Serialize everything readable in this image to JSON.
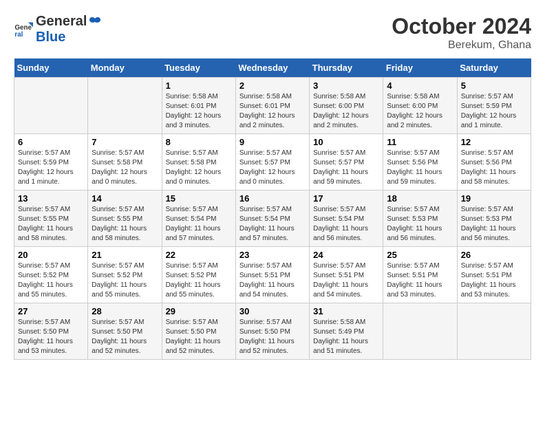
{
  "header": {
    "logo_line1": "General",
    "logo_line2": "Blue",
    "month": "October 2024",
    "location": "Berekum, Ghana"
  },
  "weekdays": [
    "Sunday",
    "Monday",
    "Tuesday",
    "Wednesday",
    "Thursday",
    "Friday",
    "Saturday"
  ],
  "weeks": [
    [
      {
        "day": "",
        "info": ""
      },
      {
        "day": "",
        "info": ""
      },
      {
        "day": "1",
        "info": "Sunrise: 5:58 AM\nSunset: 6:01 PM\nDaylight: 12 hours\nand 3 minutes."
      },
      {
        "day": "2",
        "info": "Sunrise: 5:58 AM\nSunset: 6:01 PM\nDaylight: 12 hours\nand 2 minutes."
      },
      {
        "day": "3",
        "info": "Sunrise: 5:58 AM\nSunset: 6:00 PM\nDaylight: 12 hours\nand 2 minutes."
      },
      {
        "day": "4",
        "info": "Sunrise: 5:58 AM\nSunset: 6:00 PM\nDaylight: 12 hours\nand 2 minutes."
      },
      {
        "day": "5",
        "info": "Sunrise: 5:57 AM\nSunset: 5:59 PM\nDaylight: 12 hours\nand 1 minute."
      }
    ],
    [
      {
        "day": "6",
        "info": "Sunrise: 5:57 AM\nSunset: 5:59 PM\nDaylight: 12 hours\nand 1 minute."
      },
      {
        "day": "7",
        "info": "Sunrise: 5:57 AM\nSunset: 5:58 PM\nDaylight: 12 hours\nand 0 minutes."
      },
      {
        "day": "8",
        "info": "Sunrise: 5:57 AM\nSunset: 5:58 PM\nDaylight: 12 hours\nand 0 minutes."
      },
      {
        "day": "9",
        "info": "Sunrise: 5:57 AM\nSunset: 5:57 PM\nDaylight: 12 hours\nand 0 minutes."
      },
      {
        "day": "10",
        "info": "Sunrise: 5:57 AM\nSunset: 5:57 PM\nDaylight: 11 hours\nand 59 minutes."
      },
      {
        "day": "11",
        "info": "Sunrise: 5:57 AM\nSunset: 5:56 PM\nDaylight: 11 hours\nand 59 minutes."
      },
      {
        "day": "12",
        "info": "Sunrise: 5:57 AM\nSunset: 5:56 PM\nDaylight: 11 hours\nand 58 minutes."
      }
    ],
    [
      {
        "day": "13",
        "info": "Sunrise: 5:57 AM\nSunset: 5:55 PM\nDaylight: 11 hours\nand 58 minutes."
      },
      {
        "day": "14",
        "info": "Sunrise: 5:57 AM\nSunset: 5:55 PM\nDaylight: 11 hours\nand 58 minutes."
      },
      {
        "day": "15",
        "info": "Sunrise: 5:57 AM\nSunset: 5:54 PM\nDaylight: 11 hours\nand 57 minutes."
      },
      {
        "day": "16",
        "info": "Sunrise: 5:57 AM\nSunset: 5:54 PM\nDaylight: 11 hours\nand 57 minutes."
      },
      {
        "day": "17",
        "info": "Sunrise: 5:57 AM\nSunset: 5:54 PM\nDaylight: 11 hours\nand 56 minutes."
      },
      {
        "day": "18",
        "info": "Sunrise: 5:57 AM\nSunset: 5:53 PM\nDaylight: 11 hours\nand 56 minutes."
      },
      {
        "day": "19",
        "info": "Sunrise: 5:57 AM\nSunset: 5:53 PM\nDaylight: 11 hours\nand 56 minutes."
      }
    ],
    [
      {
        "day": "20",
        "info": "Sunrise: 5:57 AM\nSunset: 5:52 PM\nDaylight: 11 hours\nand 55 minutes."
      },
      {
        "day": "21",
        "info": "Sunrise: 5:57 AM\nSunset: 5:52 PM\nDaylight: 11 hours\nand 55 minutes."
      },
      {
        "day": "22",
        "info": "Sunrise: 5:57 AM\nSunset: 5:52 PM\nDaylight: 11 hours\nand 55 minutes."
      },
      {
        "day": "23",
        "info": "Sunrise: 5:57 AM\nSunset: 5:51 PM\nDaylight: 11 hours\nand 54 minutes."
      },
      {
        "day": "24",
        "info": "Sunrise: 5:57 AM\nSunset: 5:51 PM\nDaylight: 11 hours\nand 54 minutes."
      },
      {
        "day": "25",
        "info": "Sunrise: 5:57 AM\nSunset: 5:51 PM\nDaylight: 11 hours\nand 53 minutes."
      },
      {
        "day": "26",
        "info": "Sunrise: 5:57 AM\nSunset: 5:51 PM\nDaylight: 11 hours\nand 53 minutes."
      }
    ],
    [
      {
        "day": "27",
        "info": "Sunrise: 5:57 AM\nSunset: 5:50 PM\nDaylight: 11 hours\nand 53 minutes."
      },
      {
        "day": "28",
        "info": "Sunrise: 5:57 AM\nSunset: 5:50 PM\nDaylight: 11 hours\nand 52 minutes."
      },
      {
        "day": "29",
        "info": "Sunrise: 5:57 AM\nSunset: 5:50 PM\nDaylight: 11 hours\nand 52 minutes."
      },
      {
        "day": "30",
        "info": "Sunrise: 5:57 AM\nSunset: 5:50 PM\nDaylight: 11 hours\nand 52 minutes."
      },
      {
        "day": "31",
        "info": "Sunrise: 5:58 AM\nSunset: 5:49 PM\nDaylight: 11 hours\nand 51 minutes."
      },
      {
        "day": "",
        "info": ""
      },
      {
        "day": "",
        "info": ""
      }
    ]
  ]
}
